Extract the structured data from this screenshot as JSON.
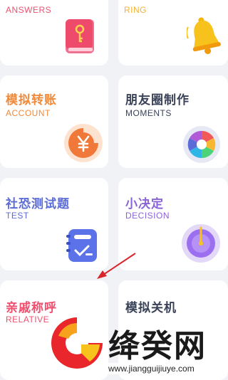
{
  "cards": [
    {
      "title": "",
      "subtitle": "ANSWERS",
      "icon": "red-book-key-icon",
      "title_color": "#f0506e",
      "sub_color": "#f0506e"
    },
    {
      "title": "",
      "subtitle": "RING",
      "icon": "yellow-bell-icon",
      "title_color": "#f2b233",
      "sub_color": "#f2b233"
    },
    {
      "title": "模拟转账",
      "subtitle": "ACCOUNT",
      "icon": "yuan-coin-icon",
      "title_color": "#f08a3a",
      "sub_color": "#f08a3a"
    },
    {
      "title": "朋友圈制作",
      "subtitle": "MOMENTS",
      "icon": "camera-aperture-icon",
      "title_color": "#3a4258",
      "sub_color": "#3a4258"
    },
    {
      "title": "社恐测试题",
      "subtitle": "TEST",
      "icon": "notebook-check-icon",
      "title_color": "#5b6cd6",
      "sub_color": "#5b6cd6"
    },
    {
      "title": "小决定",
      "subtitle": "DECISION",
      "icon": "purple-dial-icon",
      "title_color": "#8a62d8",
      "sub_color": "#8a62d8"
    },
    {
      "title": "亲戚称呼",
      "subtitle": "RELATIVE",
      "icon": "",
      "title_color": "#f0506e",
      "sub_color": "#f0506e"
    },
    {
      "title": "模拟关机",
      "subtitle": "",
      "icon": "",
      "title_color": "#3a4258",
      "sub_color": "#3a4258"
    }
  ],
  "watermark": {
    "text": "绛癸网",
    "url": "www.jiangguijiuye.com"
  },
  "colors": {
    "background": "#f1f2f6",
    "card": "#ffffff",
    "arrow": "#d9262c"
  }
}
